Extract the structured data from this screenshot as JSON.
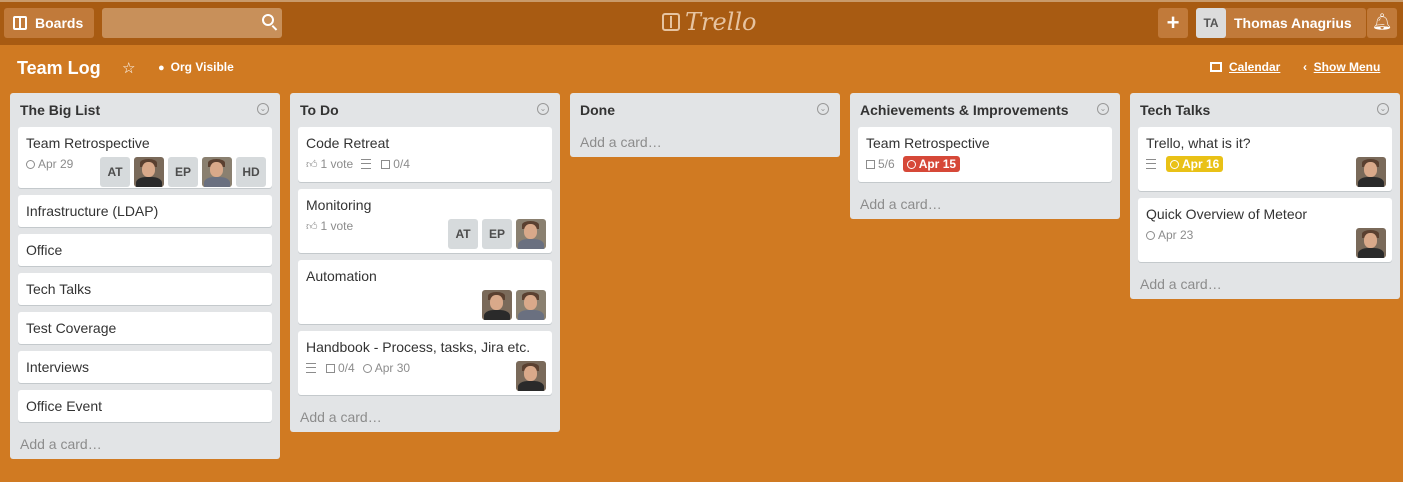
{
  "topbar": {
    "boards_label": "Boards",
    "search_placeholder": "",
    "logo_text": "Trello",
    "user_initials": "TA",
    "user_name": "Thomas Anagrius"
  },
  "board": {
    "title": "Team Log",
    "visibility": "Org Visible",
    "calendar_label": "Calendar",
    "show_menu_label": "Show Menu"
  },
  "add_card_label": "Add a card…",
  "lists": [
    {
      "title": "The Big List",
      "cards": [
        {
          "title": "Team Retrospective",
          "due": "Apr 29",
          "members": [
            "AT",
            "photo",
            "EP",
            "photo",
            "HD"
          ]
        },
        {
          "title": "Infrastructure (LDAP)"
        },
        {
          "title": "Office"
        },
        {
          "title": "Tech Talks"
        },
        {
          "title": "Test Coverage"
        },
        {
          "title": "Interviews"
        },
        {
          "title": "Office Event"
        }
      ]
    },
    {
      "title": "To Do",
      "cards": [
        {
          "title": "Code Retreat",
          "votes": "1 vote",
          "has_description": true,
          "checklist": "0/4"
        },
        {
          "title": "Monitoring",
          "votes": "1 vote",
          "members": [
            "AT",
            "EP",
            "photo"
          ]
        },
        {
          "title": "Automation",
          "members": [
            "photo",
            "photo"
          ]
        },
        {
          "title": "Handbook - Process, tasks, Jira etc.",
          "has_description": true,
          "checklist": "0/4",
          "due": "Apr 30",
          "members": [
            "photo"
          ]
        }
      ]
    },
    {
      "title": "Done",
      "cards": []
    },
    {
      "title": "Achievements & Improvements",
      "cards": [
        {
          "title": "Team Retrospective",
          "checklist": "5/6",
          "due": "Apr 15",
          "due_style": "overdue"
        }
      ]
    },
    {
      "title": "Tech Talks",
      "cards": [
        {
          "title": "Trello, what is it?",
          "has_description": true,
          "due": "Apr 16",
          "due_style": "soon",
          "members": [
            "photo"
          ]
        },
        {
          "title": "Quick Overview of Meteor",
          "due": "Apr 23",
          "members": [
            "photo"
          ]
        }
      ]
    }
  ],
  "colors": {
    "board_bg": "#d07a22",
    "topbar_bg": "#a85b12",
    "list_bg": "#e2e4e6",
    "due_overdue": "#d64838",
    "due_soon": "#e9c116"
  }
}
